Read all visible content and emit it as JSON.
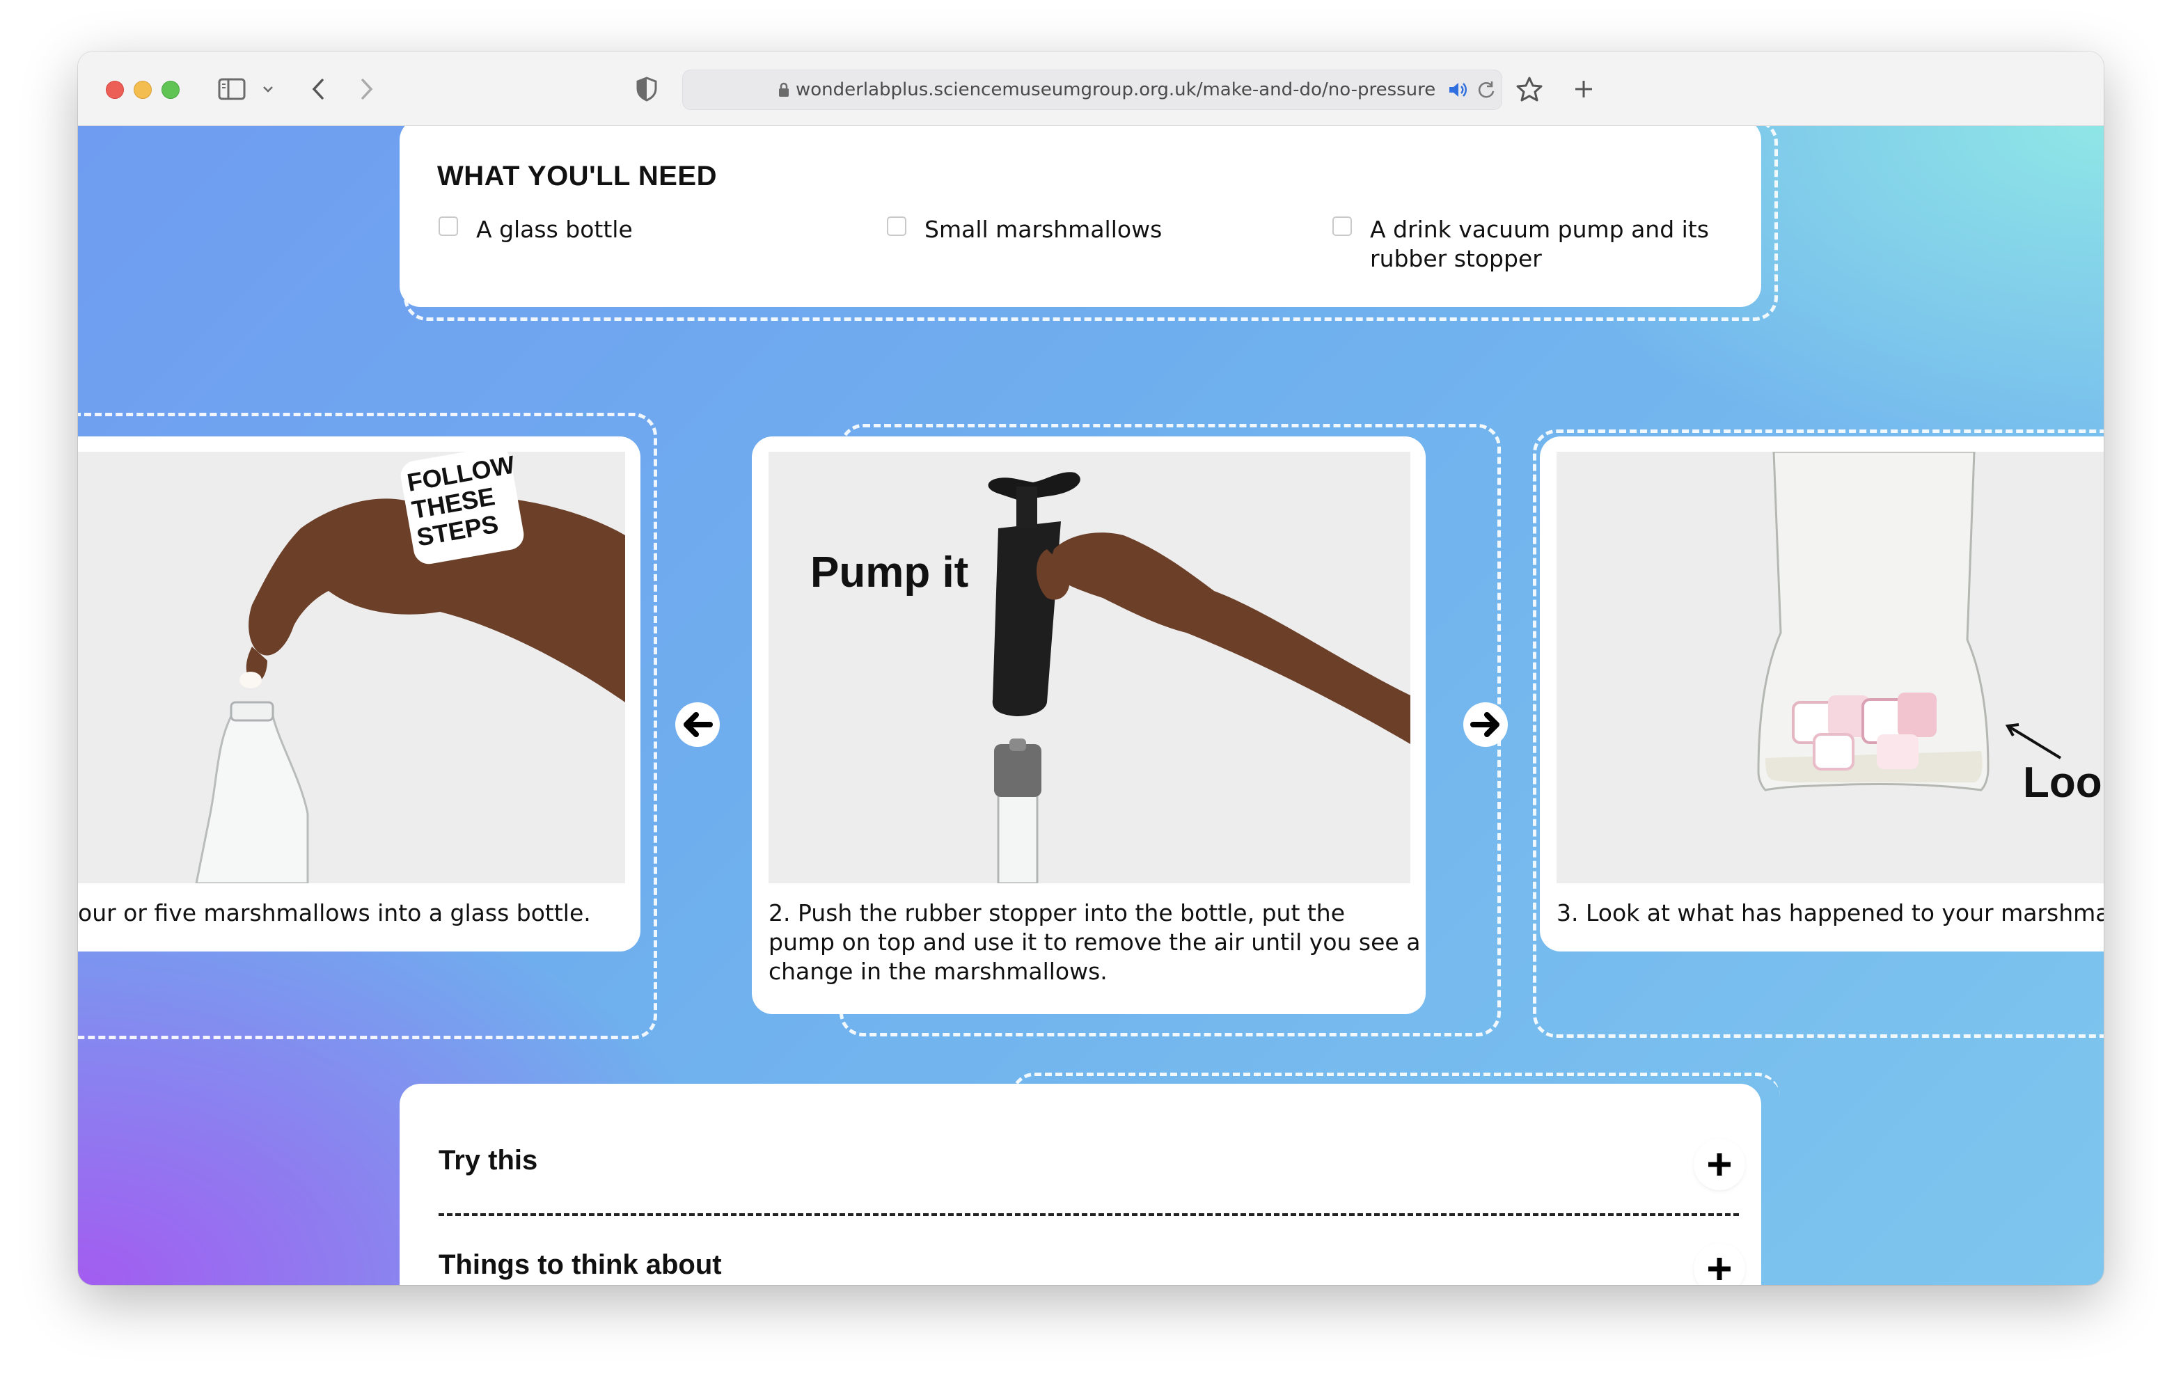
{
  "browser": {
    "url": "wonderlabplus.sciencemuseumgroup.org.uk/make-and-do/no-pressure"
  },
  "needs": {
    "title": "WHAT YOU'LL NEED",
    "items": [
      {
        "label": "A glass bottle"
      },
      {
        "label": "Small marshmallows"
      },
      {
        "label_line1": "A drink vacuum pump and its",
        "label_line2": "rubber stopper"
      }
    ]
  },
  "steps": {
    "sticker": [
      "FOLLOW",
      "THESE",
      "STEPS"
    ],
    "items": [
      {
        "text": "our or five marshmallows into a glass bottle."
      },
      {
        "photo_caption": "Pump it",
        "line1": "2.   Push the rubber stopper into the bottle, put the",
        "line2": "pump on top and use it to remove the air until you see a",
        "line3": "change in the marshmallows."
      },
      {
        "photo_caption": "Look",
        "text": "3.   Look at what has happened to your marshma"
      }
    ]
  },
  "accordion": {
    "items": [
      {
        "label": "Try this"
      },
      {
        "label": "Things to think about"
      }
    ]
  }
}
